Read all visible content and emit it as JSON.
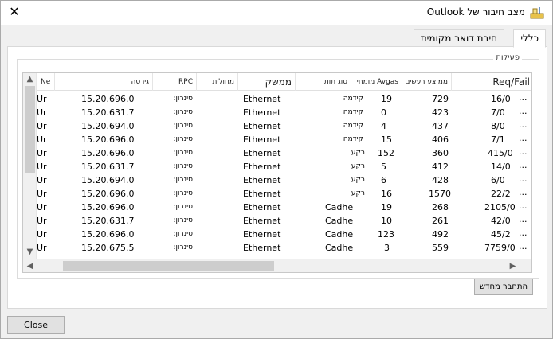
{
  "window": {
    "title": "מצב חיבור של Outlook",
    "close_glyph": "✕"
  },
  "tabs": [
    {
      "label": "כללי",
      "active": true
    },
    {
      "label": "חיבת דואר מקומית",
      "active": false
    }
  ],
  "group": {
    "label": "פעילות"
  },
  "columns": [
    "Req/Fail",
    "ממוצע רעשים",
    "Avgas מומחי",
    "סוג תות",
    "ממשק",
    "מחולית",
    "RPC",
    "גירסה",
    "Ne"
  ],
  "rows": [
    {
      "dots": "...",
      "reqfail": "16/0",
      "avg": "729",
      "avgs": "19",
      "type": "קידמה",
      "iface": "Ethernet",
      "rpc": "סינרון:",
      "ver": "15.20.696.0",
      "ne": "Ur"
    },
    {
      "dots": "...",
      "reqfail": "7/0",
      "avg": "423",
      "avgs": "0",
      "type": "קידמה",
      "iface": "Ethernet",
      "rpc": "סינרון:",
      "ver": "15.20.631.7",
      "ne": "Ur"
    },
    {
      "dots": "...",
      "reqfail": "8/0",
      "avg": "437",
      "avgs": "4",
      "type": "קידמה",
      "iface": "Ethernet",
      "rpc": "סינרון:",
      "ver": "15.20.694.0",
      "ne": "Ur"
    },
    {
      "dots": "...",
      "reqfail": "7/1",
      "avg": "406",
      "avgs": "15",
      "type": "קידמה",
      "iface": "Ethernet",
      "rpc": "סינרון:",
      "ver": "15.20.696.0",
      "ne": "Ur"
    },
    {
      "dots": "...",
      "reqfail": "415/0",
      "avg": "360",
      "avgs": "152",
      "type": "רקע",
      "iface": "Ethernet",
      "rpc": "סינרון:",
      "ver": "15.20.696.0",
      "ne": "Ur"
    },
    {
      "dots": "...",
      "reqfail": "14/0",
      "avg": "412",
      "avgs": "5",
      "type": "רקע",
      "iface": "Ethernet",
      "rpc": "סינרון:",
      "ver": "15.20.631.7",
      "ne": "Ur"
    },
    {
      "dots": "...",
      "reqfail": "6/0",
      "avg": "428",
      "avgs": "6",
      "type": "רקע",
      "iface": "Ethernet",
      "rpc": "סינרון:",
      "ver": "15.20.694.0",
      "ne": "Ur"
    },
    {
      "dots": "...",
      "reqfail": "22/2",
      "avg": "1570",
      "avgs": "16",
      "type": "רקע",
      "iface": "Ethernet",
      "rpc": "סינרון:",
      "ver": "15.20.696.0",
      "ne": "Ur"
    },
    {
      "dots": "...",
      "reqfail": "2105/0",
      "avg": "268",
      "avgs": "19",
      "type": "Cadhe",
      "iface": "Ethernet",
      "rpc": "סינרון:",
      "ver": "15.20.696.0",
      "ne": "Ur"
    },
    {
      "dots": "...",
      "reqfail": "42/0",
      "avg": "261",
      "avgs": "10",
      "type": "Cadhe",
      "iface": "Ethernet",
      "rpc": "סינרון:",
      "ver": "15.20.631.7",
      "ne": "Ur"
    },
    {
      "dots": "...",
      "reqfail": "45/2",
      "avg": "492",
      "avgs": "123",
      "type": "Cadhe",
      "iface": "Ethernet",
      "rpc": "סינרון:",
      "ver": "15.20.696.0",
      "ne": "Ur"
    },
    {
      "dots": "...",
      "reqfail": "7759/0",
      "avg": "559",
      "avgs": "3",
      "type": "Cadhe",
      "iface": "Ethernet",
      "rpc": "סינרון:",
      "ver": "15.20.675.5",
      "ne": "Ur"
    }
  ],
  "buttons": {
    "reconnect": "התחבר מחדש",
    "close": "Close",
    "close_underline": "C"
  },
  "icons": {
    "app": "outlook-app-icon",
    "scroll_up": "▲",
    "scroll_down": "▼",
    "scroll_left": "◀",
    "scroll_right": "▶"
  }
}
